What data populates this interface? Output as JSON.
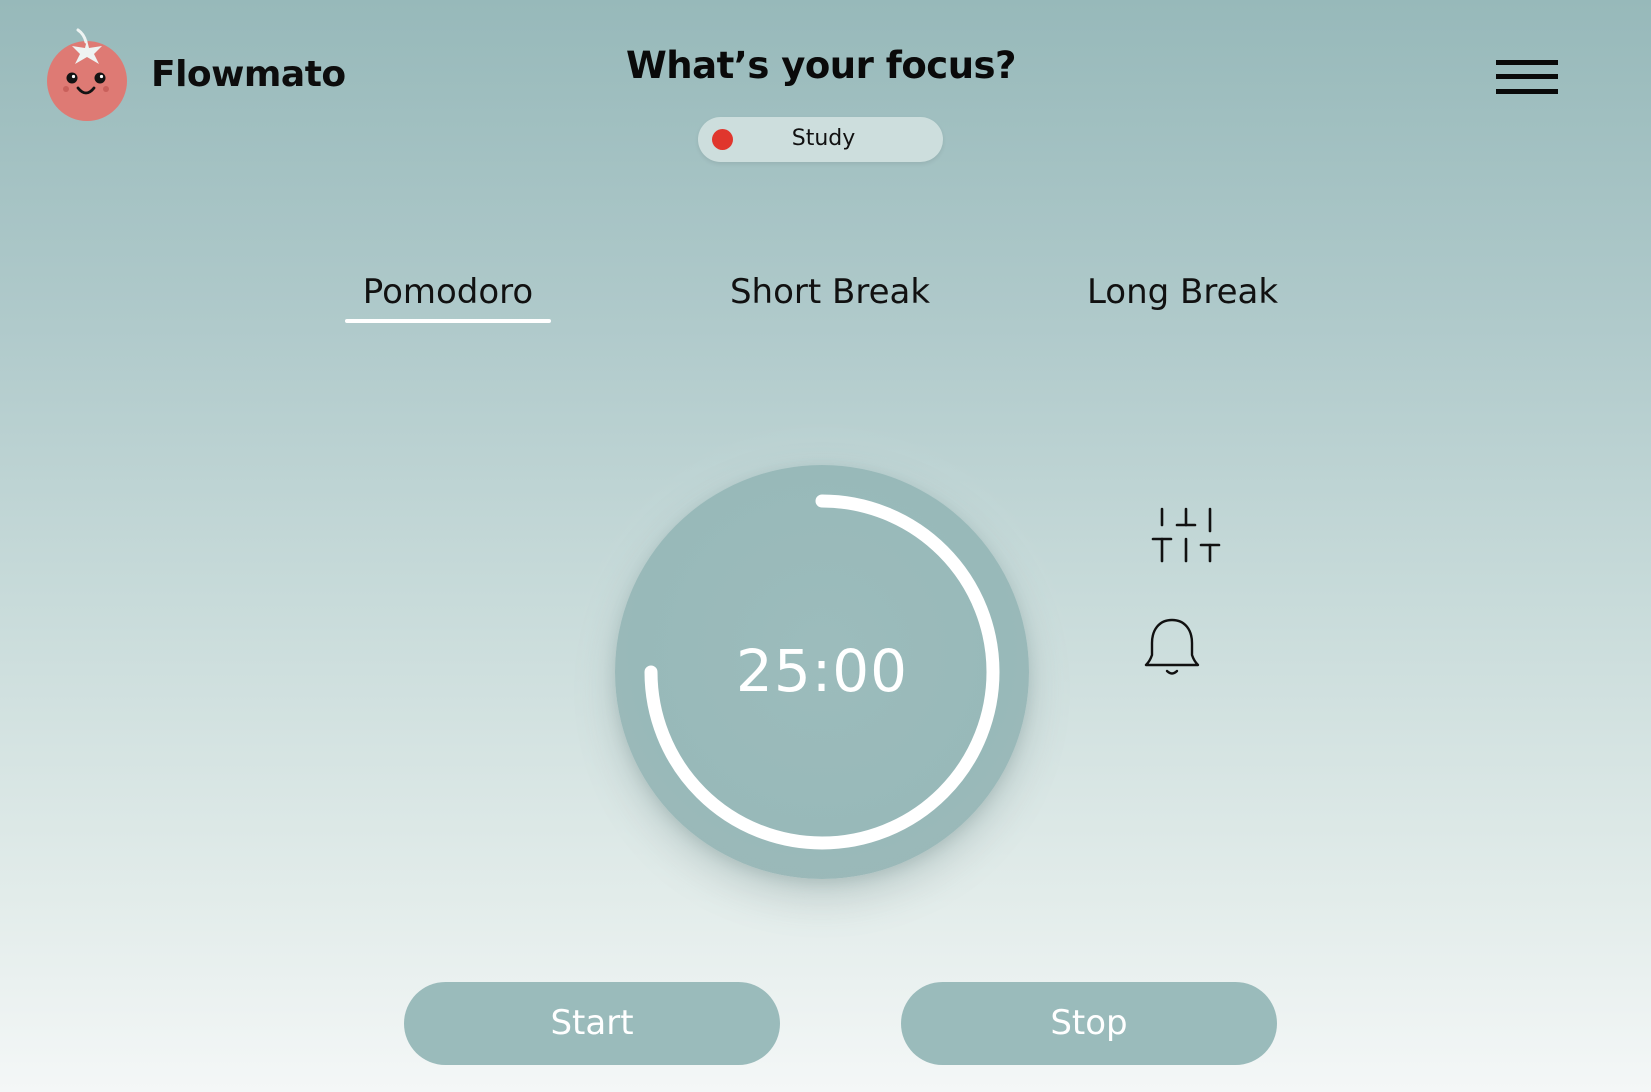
{
  "header": {
    "brand": "Flowmato",
    "focus_title": "What’s your focus?",
    "focus_selector": {
      "label": "Study",
      "dot_color": "#e0362d"
    },
    "menu_icon": "hamburger-menu-icon",
    "logo_icon": "tomato-face-icon"
  },
  "tabs": [
    {
      "label": "Pomodoro",
      "active": true
    },
    {
      "label": "Short Break",
      "active": false
    },
    {
      "label": "Long Break",
      "active": false
    }
  ],
  "timer": {
    "display": "25:00",
    "progress": 0.75
  },
  "side_icons": {
    "settings": "sliders-icon",
    "notifications": "bell-icon"
  },
  "controls": {
    "start_label": "Start",
    "stop_label": "Stop"
  },
  "colors": {
    "accent": "#9abbbb",
    "active_underline": "#ffffff",
    "tomato": "#de7a74",
    "focus_dot": "#e0362d"
  }
}
